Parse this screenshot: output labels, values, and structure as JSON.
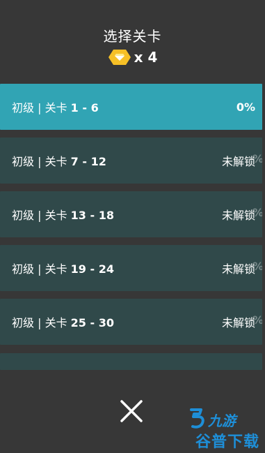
{
  "header": {
    "title": "选择关卡",
    "currency_prefix": "x",
    "currency_count": "4"
  },
  "levels": [
    {
      "label": "初级 | 关卡",
      "range": "1 - 6",
      "status": "0%",
      "ghost": "",
      "active": true
    },
    {
      "label": "初级 | 关卡",
      "range": "7 - 12",
      "status": "未解锁",
      "ghost": "%",
      "active": false
    },
    {
      "label": "初级 | 关卡",
      "range": "13 - 18",
      "status": "未解锁",
      "ghost": "%",
      "active": false
    },
    {
      "label": "初级 | 关卡",
      "range": "19 - 24",
      "status": "未解锁",
      "ghost": "%",
      "active": false
    },
    {
      "label": "初级 | 关卡",
      "range": "25 - 30",
      "status": "未解锁",
      "ghost": "%",
      "active": false
    }
  ],
  "close_icon": "close-icon",
  "watermark": {
    "top": "九游",
    "bottom": "谷普下载"
  },
  "colors": {
    "background": "#373737",
    "row": "#30494a",
    "row_active": "#31a4b4",
    "gem": "#f6c026",
    "watermark": "#1e8fd8"
  }
}
